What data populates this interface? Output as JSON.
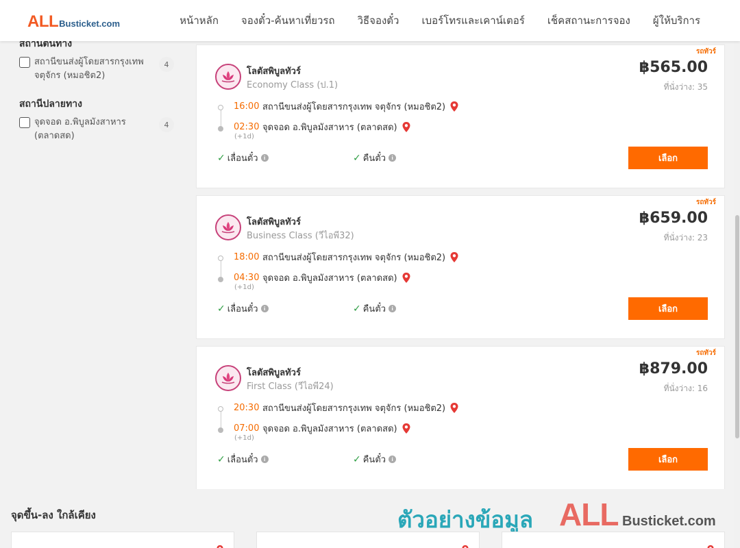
{
  "header": {
    "logo_all": "ALL",
    "logo_rest": "Busticket.com",
    "nav": [
      "หน้าหลัก",
      "จองตั๋ว-ค้นหาเที่ยวรถ",
      "วิธีจองตั๋ว",
      "เบอร์โทรและเคาน์เตอร์",
      "เช็คสถานะการจอง",
      "ผู้ให้บริการ"
    ]
  },
  "sidebar": {
    "origin_title": "สถานีต้นทาง",
    "origin_filter": {
      "label": "สถานีขนส่งผู้โดยสารกรุงเทพ จตุจักร (หมอชิต2)",
      "count": "4"
    },
    "destination_title": "สถานีปลายทาง",
    "destination_filter": {
      "label": "จุดจอด อ.พิบูลมังสาหาร (ตลาดสด)",
      "count": "4"
    }
  },
  "trips": [
    {
      "bus_type": "รถทัวร์",
      "operator": "โลตัสพิบูลทัวร์",
      "class": "Economy Class (ป.1)",
      "price": "฿565.00",
      "seats": "ที่นั่งว่าง: 35",
      "depart_time": "16:00",
      "depart_station": "สถานีขนส่งผู้โดยสารกรุงเทพ จตุจักร (หมอชิต2)",
      "arrive_time": "02:30",
      "arrive_station": "จุดจอด อ.พิบูลมังสาหาร (ตลาดสด)",
      "plus_day": "(+1d)",
      "feature_1": "เลื่อนตั๋ว",
      "feature_2": "คืนตั๋ว",
      "select_label": "เลือก"
    },
    {
      "bus_type": "รถทัวร์",
      "operator": "โลตัสพิบูลทัวร์",
      "class": "Business Class (วีไอพี32)",
      "price": "฿659.00",
      "seats": "ที่นั่งว่าง: 23",
      "depart_time": "18:00",
      "depart_station": "สถานีขนส่งผู้โดยสารกรุงเทพ จตุจักร (หมอชิต2)",
      "arrive_time": "04:30",
      "arrive_station": "จุดจอด อ.พิบูลมังสาหาร (ตลาดสด)",
      "plus_day": "(+1d)",
      "feature_1": "เลื่อนตั๋ว",
      "feature_2": "คืนตั๋ว",
      "select_label": "เลือก"
    },
    {
      "bus_type": "รถทัวร์",
      "operator": "โลตัสพิบูลทัวร์",
      "class": "First Class (วีไอพี24)",
      "price": "฿879.00",
      "seats": "ที่นั่งว่าง: 16",
      "depart_time": "20:30",
      "depart_station": "สถานีขนส่งผู้โดยสารกรุงเทพ จตุจักร (หมอชิต2)",
      "arrive_time": "07:00",
      "arrive_station": "จุดจอด อ.พิบูลมังสาหาร (ตลาดสด)",
      "plus_day": "(+1d)",
      "feature_1": "เลื่อนตั๋ว",
      "feature_2": "คืนตั๋ว",
      "select_label": "เลือก"
    }
  ],
  "nearby": {
    "title": "จุดขึ้น-ลง ใกล้เคียง"
  },
  "watermark": {
    "text": "ตัวอย่างข้อมูล",
    "all": "ALL",
    "rest": "Busticket.com"
  },
  "colors": {
    "accent": "#ff6a00",
    "time": "#f56b00",
    "pin": "#e53935",
    "check": "#2e9e43",
    "logo_all": "#f25a23",
    "logo_rest": "#2b5e8c"
  },
  "icons": {
    "pin": "map-pin-icon",
    "check": "check-icon",
    "info": "info-icon",
    "operator_logo": "lotus-logo-icon"
  }
}
